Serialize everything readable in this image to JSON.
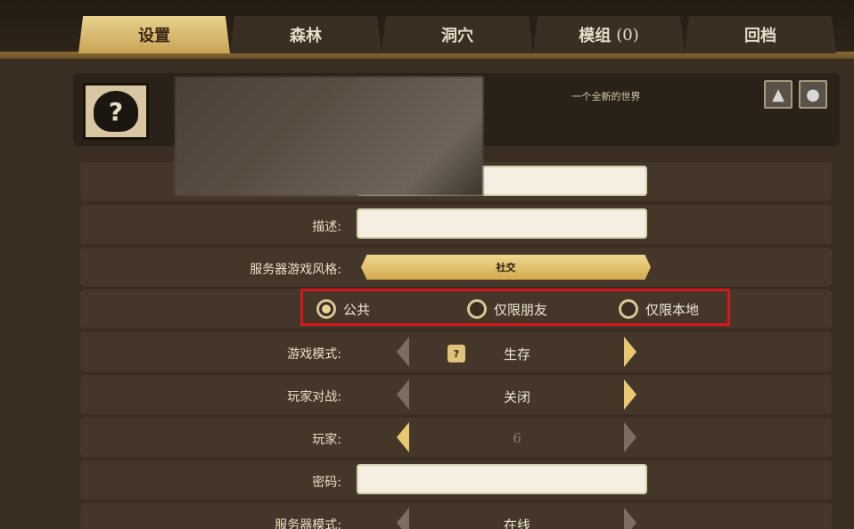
{
  "tabs": [
    {
      "label": "设置",
      "active": true
    },
    {
      "label": "森林",
      "active": false
    },
    {
      "label": "洞穴",
      "active": false
    },
    {
      "label": "模组",
      "count": "(0)",
      "active": false
    },
    {
      "label": "回档",
      "active": false
    }
  ],
  "world": {
    "title": "一个全新的世界",
    "avatar_icon": "question-mark-icon",
    "corner_icons": [
      "cave-icon",
      "globe-icon"
    ]
  },
  "settings": {
    "description_label": "描述:",
    "style_label": "服务器游戏风格:",
    "style_value": "社交",
    "visibility": {
      "options": [
        "公共",
        "仅限朋友",
        "仅限本地"
      ],
      "selected": "公共"
    },
    "game_mode_label": "游戏模式:",
    "game_mode_value": "生存",
    "pvp_label": "玩家对战:",
    "pvp_value": "关闭",
    "players_label": "玩家:",
    "players_value": "6",
    "password_label": "密码:",
    "server_mode_label": "服务器模式:",
    "server_mode_value": "在线"
  },
  "colors": {
    "accent_gold": "#e8d49a",
    "highlight_red": "#d9141c",
    "background": "#3a2e22"
  }
}
